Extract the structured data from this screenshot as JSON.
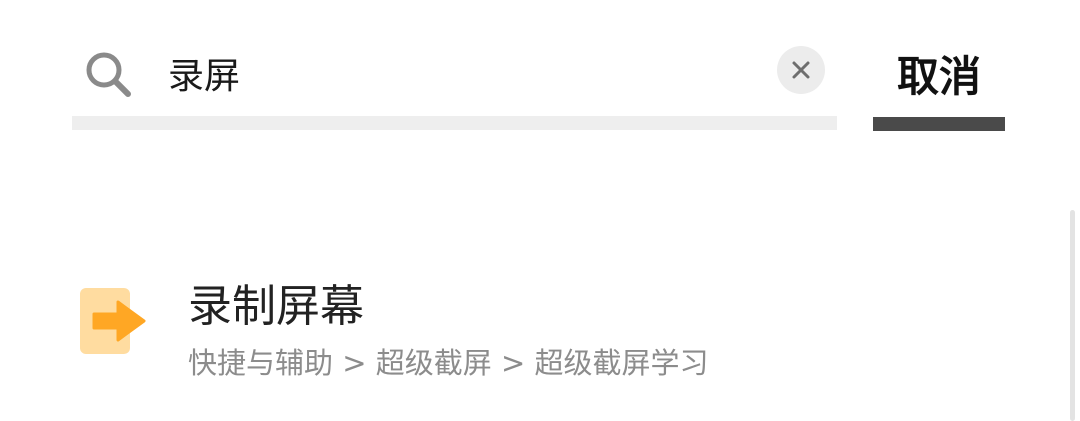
{
  "search": {
    "value": "录屏",
    "icon": "search-icon",
    "clear_icon": "close-icon"
  },
  "cancel": {
    "label": "取消"
  },
  "results": [
    {
      "title": "录制屏幕",
      "path": "快捷与辅助 > 超级截屏 > 超级截屏学习",
      "icon": "arrow-right-icon"
    }
  ],
  "colors": {
    "icon_bg": "#FFDCA0",
    "icon_arrow": "#FFA724",
    "cancel_underline": "#4A4A4A"
  }
}
